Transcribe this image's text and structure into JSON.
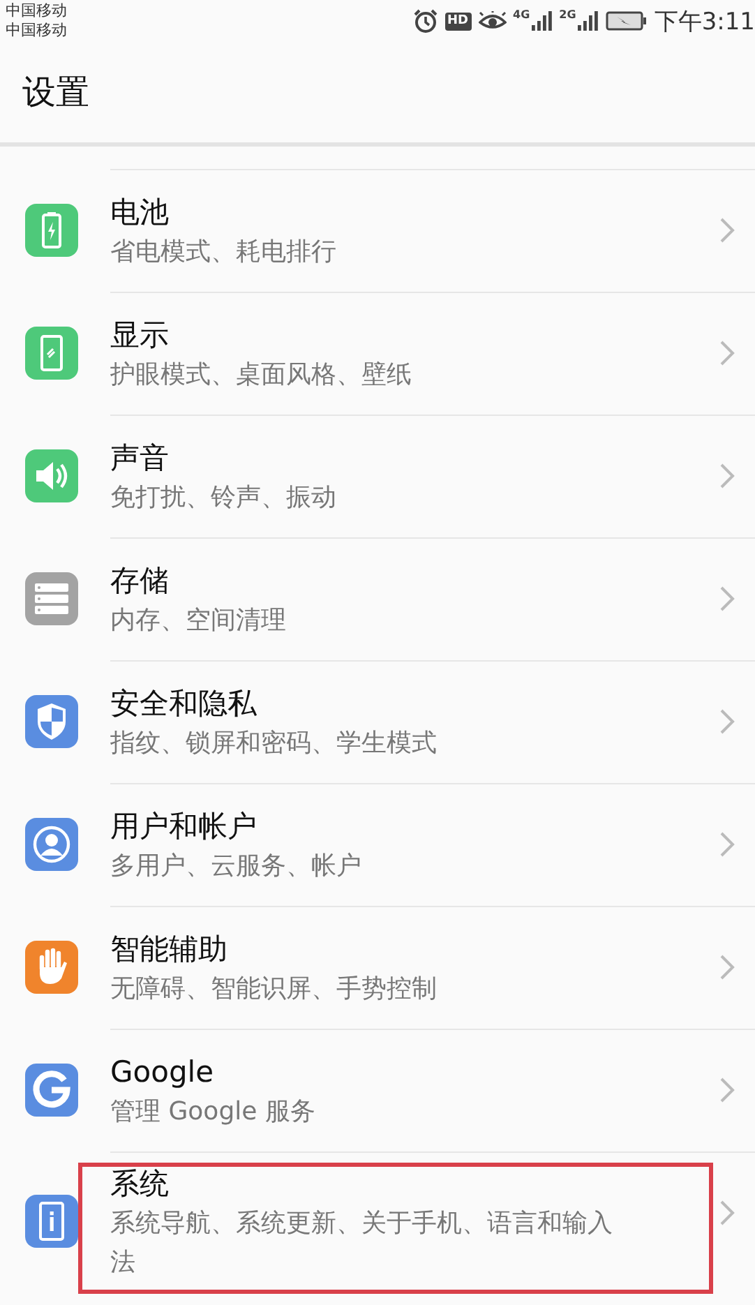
{
  "status_bar": {
    "carriers": [
      "中国移动",
      "中国移动"
    ],
    "hd_badge": "HD",
    "networks": [
      "4G",
      "2G"
    ],
    "time": "下午3:11"
  },
  "header": {
    "title": "设置"
  },
  "items": [
    {
      "kind": "battery",
      "color": "#4ec97a",
      "title": "电池",
      "subtitle": "省电模式、耗电排行",
      "highlighted": false
    },
    {
      "kind": "display",
      "color": "#4ec97a",
      "title": "显示",
      "subtitle": "护眼模式、桌面风格、壁纸",
      "highlighted": false
    },
    {
      "kind": "sound",
      "color": "#4ec97a",
      "title": "声音",
      "subtitle": "免打扰、铃声、振动",
      "highlighted": false
    },
    {
      "kind": "storage",
      "color": "#a3a3a3",
      "title": "存储",
      "subtitle": "内存、空间清理",
      "highlighted": false
    },
    {
      "kind": "shield",
      "color": "#5a8de0",
      "title": "安全和隐私",
      "subtitle": "指纹、锁屏和密码、学生模式",
      "highlighted": false
    },
    {
      "kind": "user",
      "color": "#5a8de0",
      "title": "用户和帐户",
      "subtitle": "多用户、云服务、帐户",
      "highlighted": false
    },
    {
      "kind": "hand",
      "color": "#f0842c",
      "title": "智能辅助",
      "subtitle": "无障碍、智能识屏、手势控制",
      "highlighted": false
    },
    {
      "kind": "google",
      "color": "#5a8de0",
      "title": "Google",
      "subtitle": "管理 Google 服务",
      "highlighted": false
    },
    {
      "kind": "info",
      "color": "#5a8de0",
      "title": "系统",
      "subtitle": "系统导航、系统更新、关于手机、语言和输入法",
      "highlighted": true
    }
  ]
}
